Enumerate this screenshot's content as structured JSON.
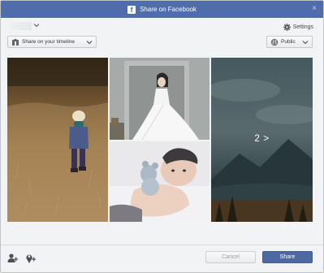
{
  "titlebar": {
    "title": "Share on Facebook",
    "logo_letter": "f",
    "close_glyph": "×"
  },
  "user": {
    "settings_label": "Settings"
  },
  "toolbar": {
    "timeline_select": "Share on your timeline",
    "privacy_select": "Public"
  },
  "gallery": {
    "photos": [
      {
        "subject": "toddler walking in autumn field"
      },
      {
        "subject": "bride in white wedding dress"
      },
      {
        "subject": "baby with teddy bear"
      },
      {
        "subject": "mountain lake landscape"
      }
    ],
    "more_label": "2 >"
  },
  "footer": {
    "cancel_label": "Cancel",
    "share_label": "Share"
  },
  "colors": {
    "facebook_blue": "#4f6dab",
    "share_button": "#4e69a2"
  },
  "icons": [
    "facebook-logo-icon",
    "close-icon",
    "chevron-down-icon",
    "settings-gear-icon",
    "timeline-icon",
    "globe-icon",
    "add-friend-icon",
    "add-location-icon"
  ]
}
